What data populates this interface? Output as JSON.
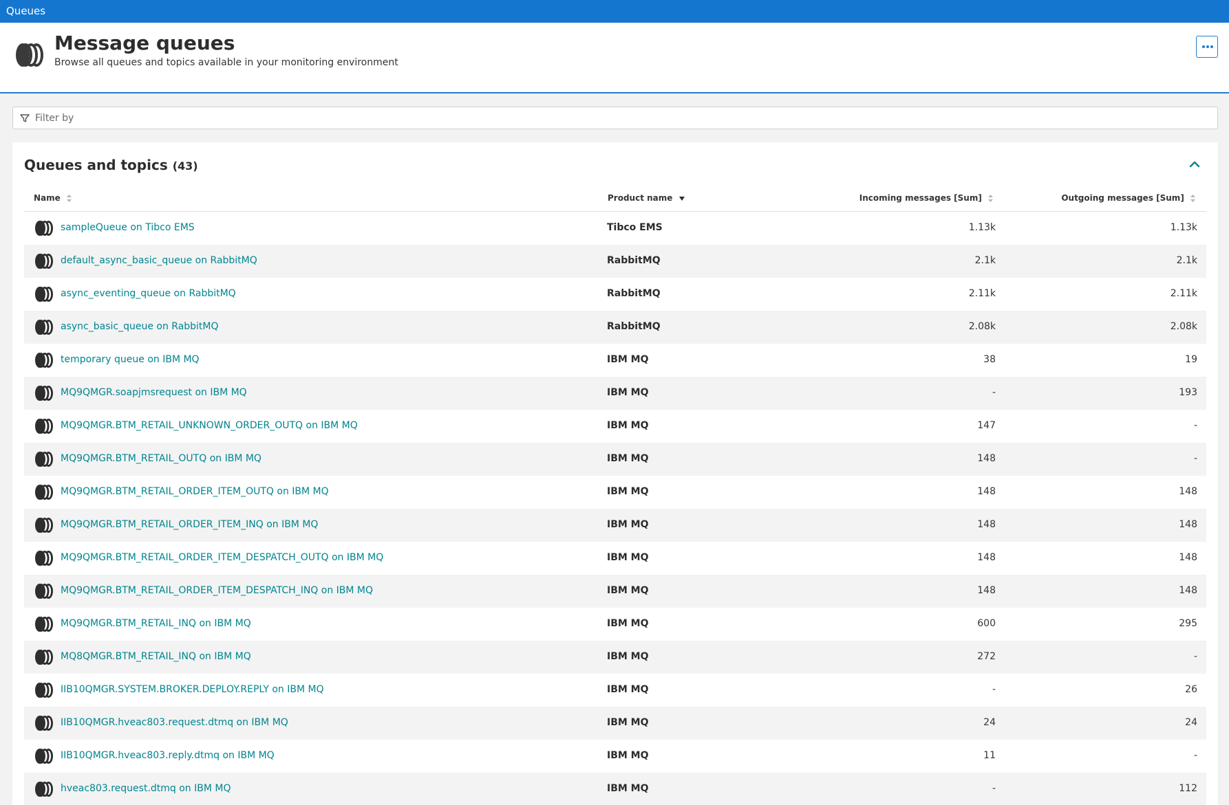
{
  "topbar": {
    "breadcrumb": "Queues"
  },
  "header": {
    "title": "Message queues",
    "subtitle": "Browse all queues and topics available in your monitoring environment",
    "icon": "message-queue-icon",
    "more_icon": "more-options-icon"
  },
  "filter": {
    "placeholder": "Filter by",
    "value": "",
    "icon": "filter-icon"
  },
  "panel": {
    "title": "Queues and topics",
    "count": "(43)",
    "collapse_icon": "chevron-up-icon",
    "accent_color": "#00858f"
  },
  "table": {
    "columns": {
      "name": "Name",
      "product": "Product name",
      "incoming": "Incoming messages [Sum]",
      "outgoing": "Outgoing messages [Sum]"
    },
    "sorted_by": "product",
    "rows": [
      {
        "name": "sampleQueue on Tibco EMS",
        "product": "Tibco EMS",
        "incoming": "1.13k",
        "outgoing": "1.13k"
      },
      {
        "name": "default_async_basic_queue on RabbitMQ",
        "product": "RabbitMQ",
        "incoming": "2.1k",
        "outgoing": "2.1k"
      },
      {
        "name": "async_eventing_queue on RabbitMQ",
        "product": "RabbitMQ",
        "incoming": "2.11k",
        "outgoing": "2.11k"
      },
      {
        "name": "async_basic_queue on RabbitMQ",
        "product": "RabbitMQ",
        "incoming": "2.08k",
        "outgoing": "2.08k"
      },
      {
        "name": "temporary queue on IBM MQ",
        "product": "IBM MQ",
        "incoming": "38",
        "outgoing": "19"
      },
      {
        "name": "MQ9QMGR.soapjmsrequest on IBM MQ",
        "product": "IBM MQ",
        "incoming": "-",
        "outgoing": "193"
      },
      {
        "name": "MQ9QMGR.BTM_RETAIL_UNKNOWN_ORDER_OUTQ on IBM MQ",
        "product": "IBM MQ",
        "incoming": "147",
        "outgoing": "-"
      },
      {
        "name": "MQ9QMGR.BTM_RETAIL_OUTQ on IBM MQ",
        "product": "IBM MQ",
        "incoming": "148",
        "outgoing": "-"
      },
      {
        "name": "MQ9QMGR.BTM_RETAIL_ORDER_ITEM_OUTQ on IBM MQ",
        "product": "IBM MQ",
        "incoming": "148",
        "outgoing": "148"
      },
      {
        "name": "MQ9QMGR.BTM_RETAIL_ORDER_ITEM_INQ on IBM MQ",
        "product": "IBM MQ",
        "incoming": "148",
        "outgoing": "148"
      },
      {
        "name": "MQ9QMGR.BTM_RETAIL_ORDER_ITEM_DESPATCH_OUTQ on IBM MQ",
        "product": "IBM MQ",
        "incoming": "148",
        "outgoing": "148"
      },
      {
        "name": "MQ9QMGR.BTM_RETAIL_ORDER_ITEM_DESPATCH_INQ on IBM MQ",
        "product": "IBM MQ",
        "incoming": "148",
        "outgoing": "148"
      },
      {
        "name": "MQ9QMGR.BTM_RETAIL_INQ on IBM MQ",
        "product": "IBM MQ",
        "incoming": "600",
        "outgoing": "295"
      },
      {
        "name": "MQ8QMGR.BTM_RETAIL_INQ on IBM MQ",
        "product": "IBM MQ",
        "incoming": "272",
        "outgoing": "-"
      },
      {
        "name": "IIB10QMGR.SYSTEM.BROKER.DEPLOY.REPLY on IBM MQ",
        "product": "IBM MQ",
        "incoming": "-",
        "outgoing": "26"
      },
      {
        "name": "IIB10QMGR.hveac803.request.dtmq on IBM MQ",
        "product": "IBM MQ",
        "incoming": "24",
        "outgoing": "24"
      },
      {
        "name": "IIB10QMGR.hveac803.reply.dtmq on IBM MQ",
        "product": "IBM MQ",
        "incoming": "11",
        "outgoing": "-"
      },
      {
        "name": "hveac803.request.dtmq on IBM MQ",
        "product": "IBM MQ",
        "incoming": "-",
        "outgoing": "112"
      }
    ]
  }
}
